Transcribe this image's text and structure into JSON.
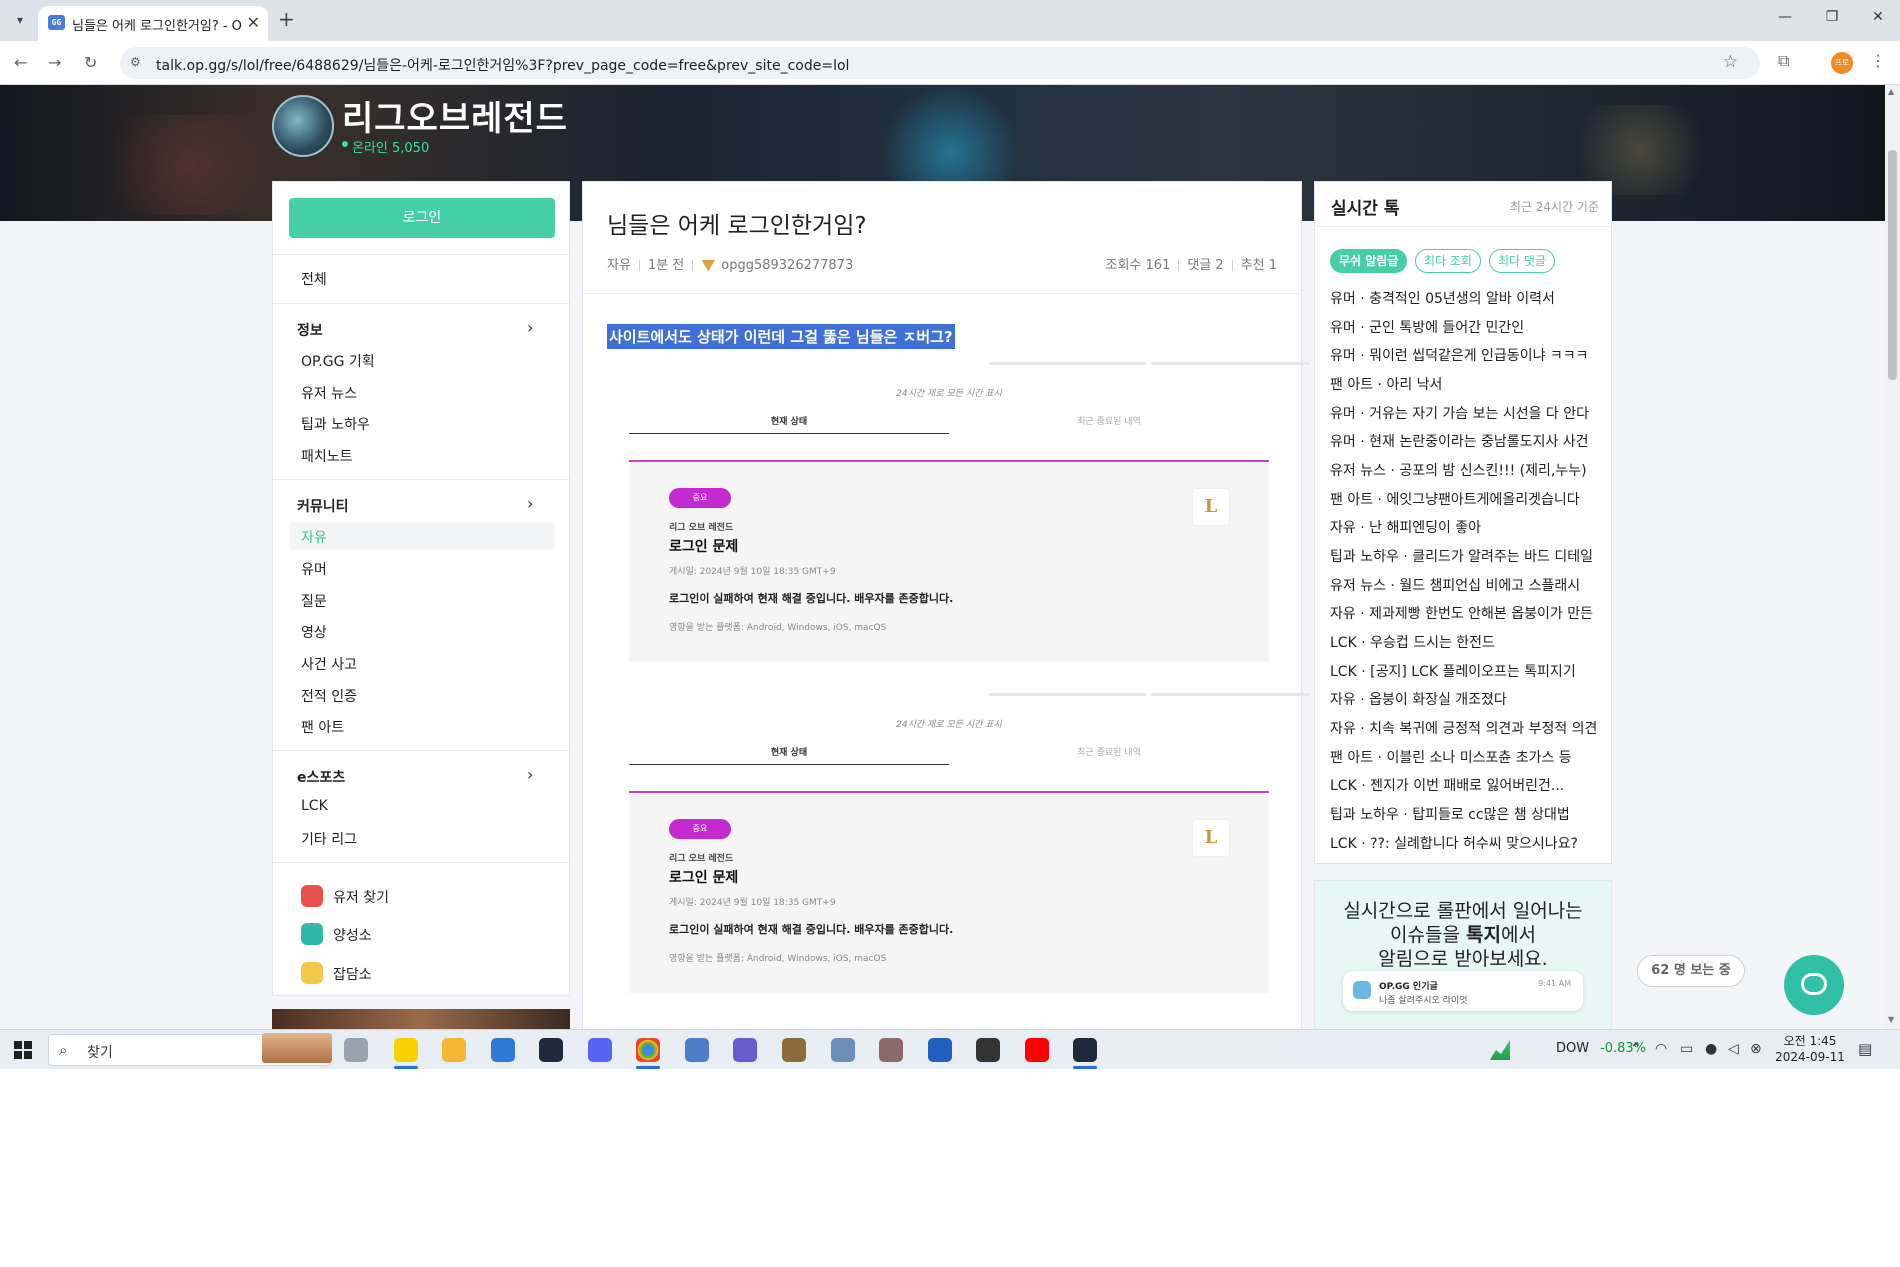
{
  "browser": {
    "tab_title": "님들은 어케 로그인한거임? - O",
    "tab_favicon_text": "GG",
    "url": "talk.op.gg/s/lol/free/6488629/님들은-어케-로그인한거임%3F?prev_page_code=free&prev_site_code=lol",
    "profile_initial": "프로"
  },
  "banner": {
    "game_title": "리그오브레전드",
    "online_label": "온라인 5,050"
  },
  "left_nav": {
    "login_label": "로그인",
    "all_label": "전체",
    "groups": [
      {
        "title": "정보",
        "items": [
          "OP.GG 기획",
          "유저 뉴스",
          "팁과 노하우",
          "패치노트"
        ]
      },
      {
        "title": "커뮤니티",
        "items": [
          "자유",
          "유머",
          "질문",
          "영상",
          "사건 사고",
          "전적 인증",
          "팬 아트"
        ]
      },
      {
        "title": "e스포츠",
        "items": [
          "LCK",
          "기타 리그"
        ]
      }
    ],
    "tools": [
      "유저 찾기",
      "양성소",
      "잡담소"
    ]
  },
  "post": {
    "title": "님들은 어케 로그인한거임?",
    "category": "자유",
    "time": "1분 전",
    "author": "opgg589326277873",
    "views": "조회수 161",
    "comments": "댓글 2",
    "likes": "추천 1",
    "selected_text": "사이트에서도 상태가 이런데 그걸 뚫은 님들은 ㅈ버그?",
    "status_images": [
      {
        "note": "24시간 제로 모든 시간 표시",
        "tab_current": "현재 상태",
        "tab_history": "최근 종료된 내역",
        "pill": "중요",
        "game": "리그 오브 레전드",
        "heading": "로그인 문제",
        "posted": "게시일: 2024년 9월 10일 18:35 GMT+9",
        "description": "로그인이 실패하여 현재 해결 중입니다. 배우자를 존중합니다.",
        "platforms": "영향을 받는 플랫폼: Android, Windows, iOS, macOS",
        "logo": "L"
      },
      {
        "note": "24시간 제로 모든 시간 표시",
        "tab_current": "현재 상태",
        "tab_history": "최근 종료된 내역",
        "pill": "중요",
        "game": "리그 오브 레전드",
        "heading": "로그인 문제",
        "posted": "게시일: 2024년 9월 10일 18:35 GMT+9",
        "description": "로그인이 실패하여 현재 해결 중입니다. 배우자를 존중합니다.",
        "platforms": "영향을 받는 플랫폼: Android, Windows, iOS, macOS",
        "logo": "L"
      }
    ]
  },
  "realtime": {
    "title": "실시간 톡",
    "subtitle": "최근 24시간 기준",
    "chips": [
      "무쉬 알림글",
      "최다 조회",
      "최다 댓글"
    ],
    "items": [
      "유머 · 충격적인 05년생의 알바 이력서",
      "유머 · 군인 톡방에 들어간 민간인",
      "유머 · 뭐이런 씹덕같은게 인급동이냐 ㅋㅋㅋ",
      "팬 아트 · 아리 낙서",
      "유머 · 거유는 자기 가슴 보는 시선을 다 안다",
      "유머 · 현재 논란중이라는 중남롤도지사 사건",
      "유저 뉴스 · 공포의 밤 신스킨!!! (제리,누누)",
      "팬 아트 · 에잇그냥팬아트게에올리겟습니다",
      "자유 · 난 해피엔딩이 좋아",
      "팁과 노하우 · 클리드가 알려주는 바드 디테일",
      "유저 뉴스 · 월드 챔피언십 비에고 스플래시",
      "자유 · 제과제빵 한번도 안해본 옵붕이가 만든",
      "LCK · 우승컵 드시는 한전드",
      "LCK · [공지] LCK 플레이오프는 톡피지기",
      "자유 · 옵붕이 화장실 개조졌다",
      "자유 · 치속 복귀에 긍정적 의견과 부정적 의견",
      "팬 아트 · 이블린 소나 미스포츈 초가스 등",
      "LCK · 젠지가 이번 패배로 잃어버린건...",
      "팁과 노하우 · 탑피들로 cc많은 챔 상대법",
      "LCK · ??: 실례합니다 허수씨 맞으시나요?"
    ]
  },
  "promo": {
    "line1": "실시간으로 롤판에서 일어나는",
    "line2_pre": "이슈들을 ",
    "line2_bold": "톡지",
    "line2_post": "에서",
    "line3": "알림으로 받아보세요.",
    "phone_app": "OP.GG 인기글",
    "phone_msg": "나좀 살려주시오 라이엇",
    "phone_time": "9:41 AM"
  },
  "widgets": {
    "viewers": "62 명 보는 중"
  },
  "taskbar": {
    "search_placeholder": "찾기",
    "stock_name": "DOW",
    "stock_change": "-0.83%",
    "clock_time": "오전 1:45",
    "clock_date": "2024-09-11"
  },
  "colors": {
    "accent": "#46cfa7",
    "selection": "#3f6fd8",
    "status_line": "#c93fd1",
    "status_pill": "#c32bd0",
    "stock_up": "#1a8f3b"
  }
}
